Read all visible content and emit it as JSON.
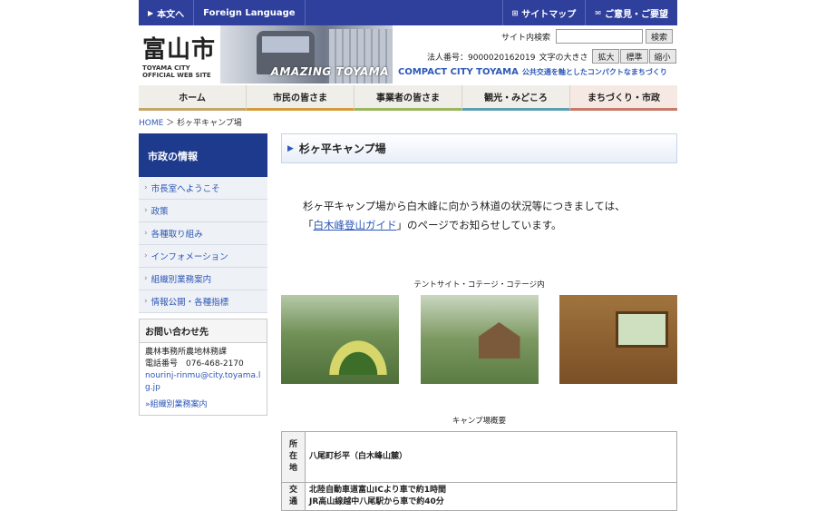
{
  "topbar": {
    "skip": "本文へ",
    "foreign": "Foreign Language",
    "sitemap": "サイトマップ",
    "feedback": "ご意見・ご要望"
  },
  "header": {
    "logo_big": "富山市",
    "logo_small1": "TOYAMA CITY",
    "logo_small2": "OFFICIAL WEB SITE",
    "banner_text": "AMAZING TOYAMA",
    "search_label": "サイト内検索",
    "search_button": "検索",
    "corp_number": "法人番号：9000020162019",
    "text_size_label": "文字の大きさ",
    "size_large": "拡大",
    "size_normal": "標準",
    "size_small": "縮小",
    "tagline": "COMPACT CITY TOYAMA",
    "tagline_sub": "公共交通を軸としたコンパクトなまちづくり"
  },
  "nav": [
    "ホーム",
    "市民の皆さま",
    "事業者の皆さま",
    "観光・みどころ",
    "まちづくり・市政"
  ],
  "breadcrumb": {
    "home": "HOME",
    "sep": "＞",
    "current": "杉ヶ平キャンプ場"
  },
  "sidebar": {
    "title": "市政の情報",
    "items": [
      "市長室へようこそ",
      "政策",
      "各種取り組み",
      "インフォメーション",
      "組織別業務案内",
      "情報公開・各種指標"
    ],
    "contact": {
      "title": "お問い合わせ先",
      "dept": "農林事務所農地林務課",
      "phone": "電話番号　076-468-2170",
      "email": "nourinj-rinmu@city.toyama.lg.jp",
      "link": "組織別業務案内"
    }
  },
  "main": {
    "title": "杉ヶ平キャンプ場",
    "intro1": "杉ヶ平キャンプ場から白木峰に向かう林道の状況等につきましては、",
    "intro2_pre": "「",
    "intro2_link": "白木峰登山ガイド",
    "intro2_post": "」のページでお知らせしています。",
    "photo_caption": "テントサイト・コテージ・コテージ内",
    "table_caption": "キャンプ場概要",
    "table": [
      {
        "key": "所在地",
        "value": "八尾町杉平（白木峰山麓）"
      },
      {
        "key": "交通",
        "value_lines": [
          "北陸自動車道富山ICより車で約1時間",
          "JR高山線越中八尾駅から車で約40分"
        ]
      }
    ]
  }
}
